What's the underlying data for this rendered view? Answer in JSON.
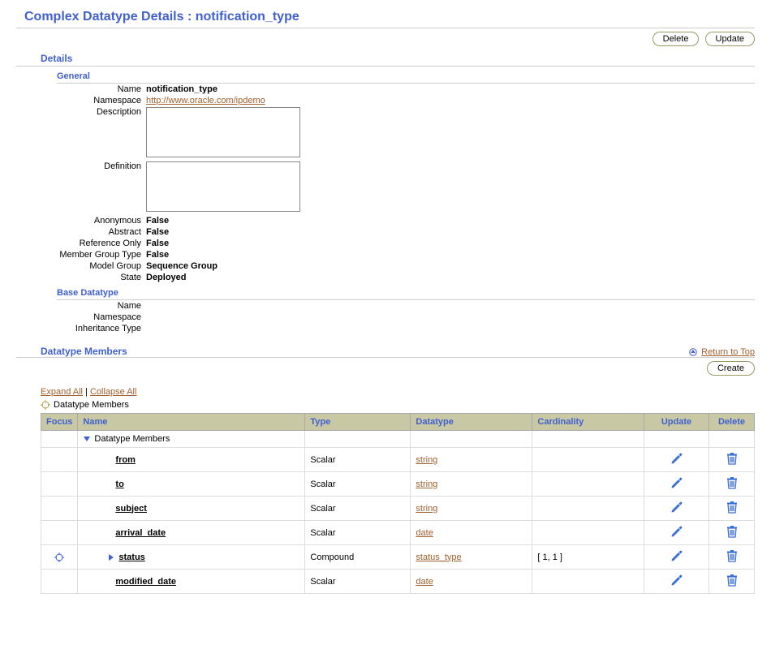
{
  "page": {
    "title_prefix": "Complex Datatype Details : ",
    "title_name": "notification_type",
    "buttons": {
      "delete": "Delete",
      "update": "Update",
      "create": "Create"
    }
  },
  "sections": {
    "details": "Details",
    "general": "General",
    "base_datatype": "Base Datatype",
    "datatype_members": "Datatype Members"
  },
  "general": {
    "labels": {
      "name": "Name",
      "namespace": "Namespace",
      "description": "Description",
      "definition": "Definition",
      "anonymous": "Anonymous",
      "abstract": "Abstract",
      "reference_only": "Reference Only",
      "member_group_type": "Member Group Type",
      "model_group": "Model Group",
      "state": "State"
    },
    "values": {
      "name": "notification_type",
      "namespace": "http://www.oracle.com/ipdemo",
      "description": "",
      "definition": "",
      "anonymous": "False",
      "abstract": "False",
      "reference_only": "False",
      "member_group_type": "False",
      "model_group": "Sequence Group",
      "state": "Deployed"
    }
  },
  "base": {
    "labels": {
      "name": "Name",
      "namespace": "Namespace",
      "inheritance_type": "Inheritance Type"
    },
    "values": {
      "name": "",
      "namespace": "",
      "inheritance_type": ""
    }
  },
  "member_links": {
    "return_top": "Return to Top",
    "expand_all": "Expand All",
    "collapse_all": "Collapse All",
    "breadcrumb_root": "Datatype Members"
  },
  "member_table": {
    "headers": {
      "focus": "Focus",
      "name": "Name",
      "type": "Type",
      "datatype": "Datatype",
      "cardinality": "Cardinality",
      "update": "Update",
      "delete": "Delete"
    },
    "root_label": "Datatype Members",
    "rows": [
      {
        "name": "from",
        "type": "Scalar",
        "datatype": "string",
        "cardinality": "",
        "expandable": false,
        "focusable": false
      },
      {
        "name": "to",
        "type": "Scalar",
        "datatype": "string",
        "cardinality": "",
        "expandable": false,
        "focusable": false
      },
      {
        "name": "subject",
        "type": "Scalar",
        "datatype": "string",
        "cardinality": "",
        "expandable": false,
        "focusable": false
      },
      {
        "name": "arrival_date",
        "type": "Scalar",
        "datatype": "date",
        "cardinality": "",
        "expandable": false,
        "focusable": false
      },
      {
        "name": "status",
        "type": "Compound",
        "datatype": "status_type",
        "cardinality": "[ 1, 1 ]",
        "expandable": true,
        "focusable": true
      },
      {
        "name": "modified_date",
        "type": "Scalar",
        "datatype": "date",
        "cardinality": "",
        "expandable": false,
        "focusable": false
      }
    ]
  }
}
